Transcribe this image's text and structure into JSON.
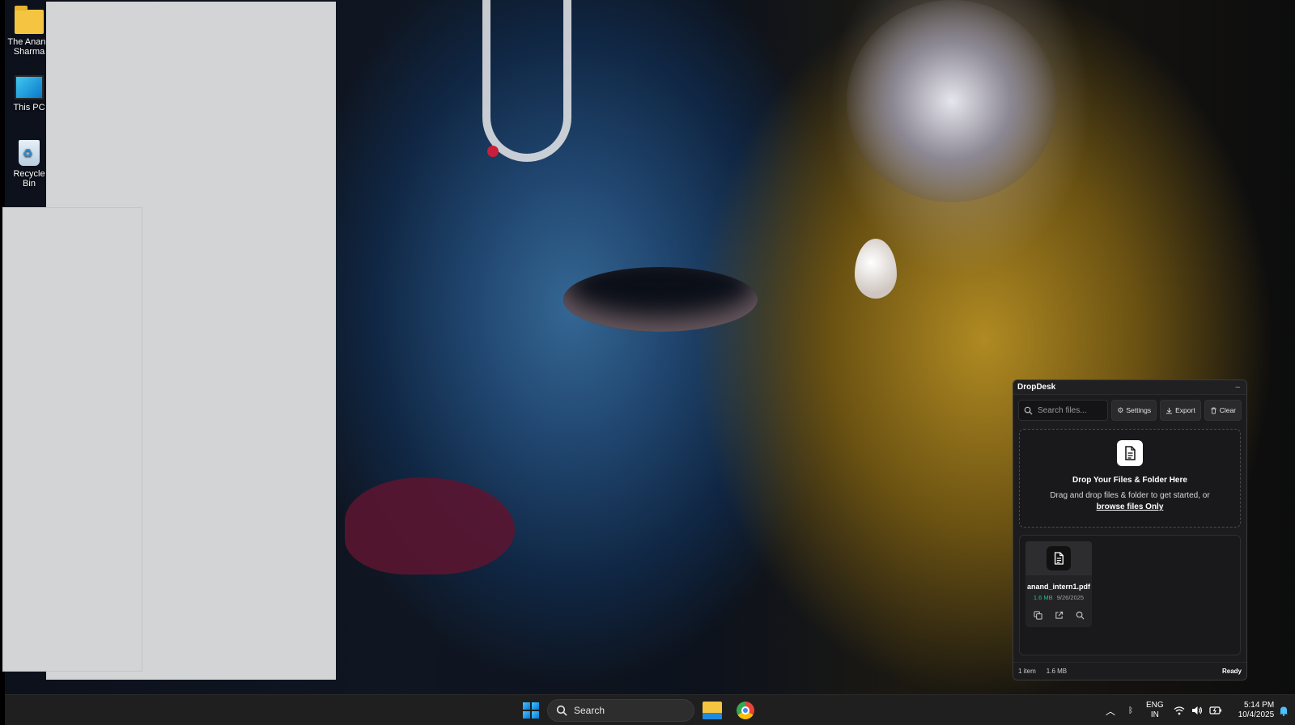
{
  "desktop": {
    "icons": [
      {
        "label": "The Anand Sharma",
        "icon": "folder-icon"
      },
      {
        "label": "This PC",
        "icon": "monitor-icon"
      },
      {
        "label": "Recycle Bin",
        "icon": "recycle-bin-icon"
      }
    ]
  },
  "dropdesk": {
    "title": "DropDesk",
    "minimize": "–",
    "search_placeholder": "Search files...",
    "toolbar": {
      "settings": "Settings",
      "export": "Export",
      "clear": "Clear"
    },
    "dropzone": {
      "title": "Drop Your Files & Folder Here",
      "subtitle": "Drag and drop files & folder to get started, or",
      "browse": "browse files Only"
    },
    "files": [
      {
        "name": "anand_intern1.pdf",
        "size": "1.6 MB",
        "date": "9/26/2025"
      }
    ],
    "status": {
      "count": "1 item",
      "total_size": "1.6 MB",
      "state": "Ready"
    }
  },
  "taskbar": {
    "search_label": "Search",
    "language": "ENG",
    "region": "IN",
    "time": "5:14 PM",
    "date": "10/4/2025"
  },
  "colors": {
    "accent": "#0078d4",
    "file_size_green": "#22c27a",
    "panel_bg": "#1c1c1e"
  }
}
